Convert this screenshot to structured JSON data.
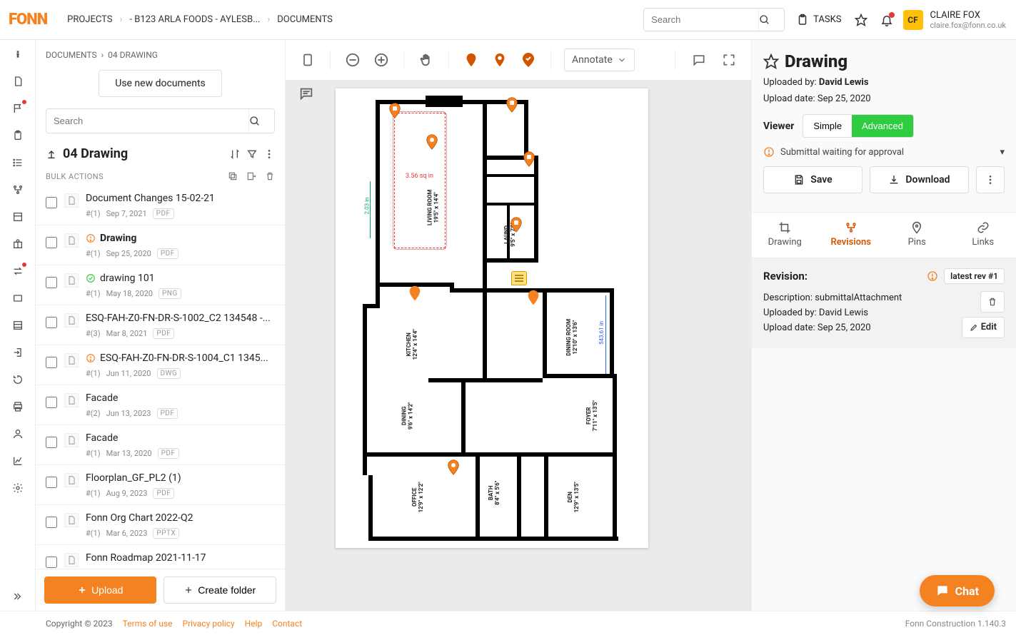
{
  "header": {
    "breadcrumbs": [
      "PROJECTS",
      "- B123 ARLA FOODS - AYLESB...",
      "DOCUMENTS"
    ],
    "search_placeholder": "Search",
    "tasks_label": "TASKS",
    "user": {
      "initials": "CF",
      "name": "CLAIRE FOX",
      "email": "claire.fox@fonn.co.uk"
    }
  },
  "sidebar": {
    "crumb": [
      "DOCUMENTS",
      "04 DRAWING"
    ],
    "use_new_btn": "Use new documents",
    "search_placeholder": "Search",
    "folder_title": "04 Drawing",
    "bulk_label": "BULK ACTIONS",
    "docs": [
      {
        "title": "Document Changes 15-02-21",
        "rev": "#(1)",
        "date": "Sep 7, 2021",
        "type": "PDF",
        "status": ""
      },
      {
        "title": "Drawing",
        "rev": "#(1)",
        "date": "Sep 25, 2020",
        "type": "PDF",
        "status": "warn",
        "active": true
      },
      {
        "title": "drawing 101",
        "rev": "#(1)",
        "date": "May 18, 2020",
        "type": "PNG",
        "status": "ok"
      },
      {
        "title": "ESQ-FAH-Z0-FN-DR-S-1002_C2 134548 -...",
        "rev": "#(3)",
        "date": "Mar 8, 2021",
        "type": "PDF",
        "status": ""
      },
      {
        "title": "ESQ-FAH-Z0-FN-DR-S-1004_C1 1345...",
        "rev": "#(1)",
        "date": "Jun 11, 2020",
        "type": "DWG",
        "status": "warn"
      },
      {
        "title": "Facade",
        "rev": "#(2)",
        "date": "Jun 13, 2023",
        "type": "PDF",
        "status": ""
      },
      {
        "title": "Facade",
        "rev": "#(1)",
        "date": "Mar 13, 2020",
        "type": "PDF",
        "status": ""
      },
      {
        "title": "Floorplan_GF_PL2 (1)",
        "rev": "#(1)",
        "date": "Aug 9, 2023",
        "type": "PDF",
        "status": ""
      },
      {
        "title": "Fonn Org Chart 2022-Q2",
        "rev": "#(1)",
        "date": "Mar 6, 2023",
        "type": "PPTX",
        "status": ""
      },
      {
        "title": "Fonn Roadmap 2021-11-17",
        "rev": "",
        "date": "",
        "type": "",
        "status": ""
      }
    ],
    "upload_btn": "Upload",
    "create_btn": "Create folder"
  },
  "toolbar": {
    "annotate_label": "Annotate"
  },
  "plan": {
    "area": "3.56 sq in",
    "green_measure": "2.03 in",
    "blue_measure": "543.61 in",
    "rooms": {
      "living": "LIVING ROOM\n19'5\" x 14'4\"",
      "laundry": "LAUND\n9'5\" x 7'0\"",
      "kitchen": "KITCHEN\n12'4\" x 14'4\"",
      "dining_room": "DINING ROOM\n12'10\" x 13'6\"",
      "dining": "DINING\n9'6\" x 14'2\"",
      "foyer": "FOYER\n7'11\" x 13'5\"",
      "office": "OFFICE\n12'9\" x 12'2\"",
      "bath": "BATH\n8'4\" x 5'6\"",
      "den": "DEN\n12'9\" x 13'5\""
    }
  },
  "details": {
    "title": "Drawing",
    "uploaded_by_label": "Uploaded by: ",
    "uploaded_by": "David Lewis",
    "upload_date_label": "Upload date: ",
    "upload_date": "Sep 25, 2020",
    "viewer_label": "Viewer",
    "simple": "Simple",
    "advanced": "Advanced",
    "alert": "Submittal waiting for approval",
    "save": "Save",
    "download": "Download",
    "tabs": [
      "Drawing",
      "Revisions",
      "Pins",
      "Links"
    ],
    "revision": {
      "head": "Revision:",
      "latest": "latest rev #1",
      "desc_label": "Description: ",
      "desc": "submittalAttachment",
      "by_label": "Uploaded by: ",
      "by": "David Lewis",
      "date_label": "Upload date: ",
      "date": "Sep 25, 2020",
      "edit": "Edit"
    }
  },
  "footer": {
    "copyright": "Copyright © 2023",
    "links": [
      "Terms of use",
      "Privacy policy",
      "Help",
      "Contact"
    ],
    "version": "Fonn Construction 1.140.3"
  },
  "chat": "Chat"
}
